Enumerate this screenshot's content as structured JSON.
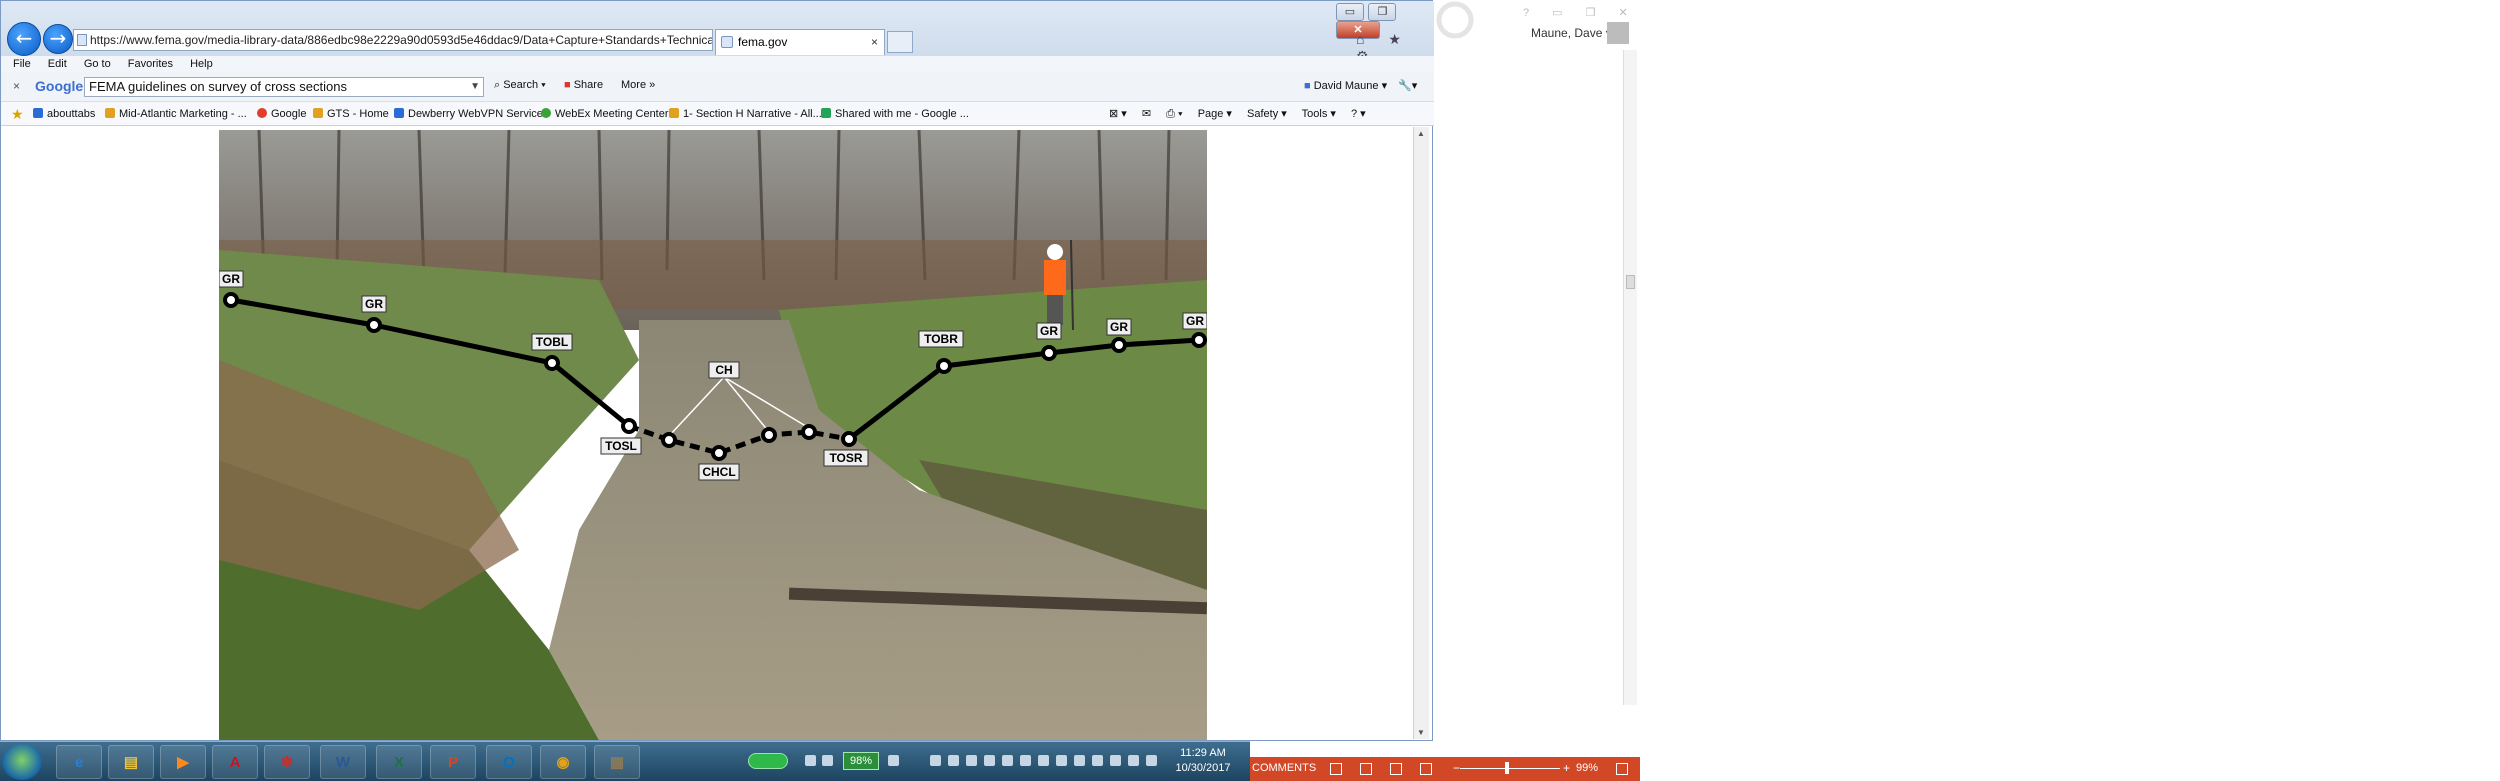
{
  "browser": {
    "url": "https://www.fema.gov/media-library-data/886edbc98e2229a90d0593d5e46ddac9/Data+Capture+Standards+Technical+Re",
    "address_tools": "⌕ ▾ 🔒 ↻ ✕",
    "tab_label": "fema.gov",
    "tab_close": "×",
    "window_buttons": {
      "minimize": "▭",
      "restore": "❐",
      "close": "✕"
    },
    "top_icons": "⌂ ★ ⚙"
  },
  "menu": {
    "items": [
      "File",
      "Edit",
      "Go to",
      "Favorites",
      "Help"
    ]
  },
  "google_toolbar": {
    "close": "×",
    "logo": "Google",
    "query": "FEMA guidelines on survey of cross sections",
    "search": "Search ▾",
    "share": "Share",
    "more": "More »",
    "user": "David Maune ▾",
    "wrench": "▾"
  },
  "favorites": [
    {
      "label": "abouttabs",
      "color": "#2b6bd6"
    },
    {
      "label": "Mid-Atlantic Marketing - ...",
      "color": "#e0a020"
    },
    {
      "label": "Google",
      "color": "#e23c2a"
    },
    {
      "label": "GTS - Home",
      "color": "#e0a020"
    },
    {
      "label": "Dewberry WebVPN Service",
      "color": "#2b6bd6"
    },
    {
      "label": "WebEx Meeting Center",
      "color": "#3aa23a"
    },
    {
      "label": "1- Section H Narrative - All...",
      "color": "#e0a020"
    },
    {
      "label": "Shared with me - Google ...",
      "color": "#25a25a"
    }
  ],
  "command_bar": [
    "Page ▾",
    "Safety ▾",
    "Tools ▾",
    "? ▾"
  ],
  "photo_labels": {
    "gr": "GR",
    "tobl": "TOBL",
    "tosl": "TOSL",
    "ch": "CH",
    "chcl": "CHCL",
    "tosr": "TOSR",
    "tobr": "TOBR"
  },
  "word_panel": {
    "user": "Maune, Dave ▾",
    "title_icons": "? ▭ ❐ ✕"
  },
  "taskbar": {
    "apps": [
      {
        "label": "e",
        "color": "#2a7fd6"
      },
      {
        "label": "▤",
        "color": "#e8c240"
      },
      {
        "label": "▶",
        "color": "#ff8a1a"
      },
      {
        "label": "A",
        "color": "#c8141e"
      },
      {
        "label": "✱",
        "color": "#b33"
      },
      {
        "label": "W",
        "color": "#2b5797"
      },
      {
        "label": "X",
        "color": "#1f7244"
      },
      {
        "label": "P",
        "color": "#d24726"
      },
      {
        "label": "O",
        "color": "#0072c6"
      },
      {
        "label": "◉",
        "color": "#e3a21a"
      },
      {
        "label": "▦",
        "color": "#8a7a5a"
      }
    ],
    "battery": "98%",
    "time": "11:29 AM",
    "date": "10/30/2017"
  },
  "word_status": {
    "comments": "COMMENTS",
    "minus": "−",
    "plus": "+",
    "zoom": "99%"
  }
}
